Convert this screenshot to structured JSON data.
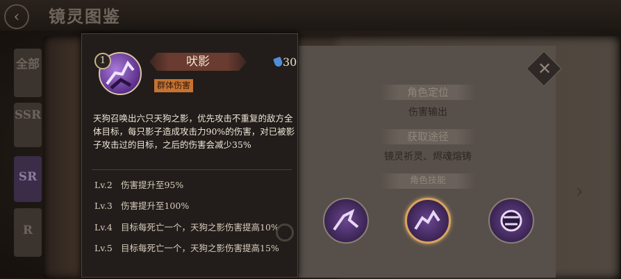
{
  "header": {
    "title": "镜灵图鉴",
    "back_label": "‹"
  },
  "tabs": [
    {
      "label": "全部",
      "active": false
    },
    {
      "label": "SSR",
      "active": false
    },
    {
      "label": "SR",
      "active": true
    },
    {
      "label": "R",
      "active": false
    }
  ],
  "skill_popup": {
    "level": "1",
    "name": "吠影",
    "cost": "30",
    "tag": "群体伤害",
    "description": "天狗召唤出六只天狗之影，优先攻击不重复的敌方全体目标，每只影子造成攻击力90%的伤害，对已被影子攻击过的目标，之后的伤害会减少35%",
    "levels": [
      {
        "label": "Lv.2",
        "text": "伤害提升至95%"
      },
      {
        "label": "Lv.3",
        "text": "伤害提升至100%"
      },
      {
        "label": "Lv.4",
        "text": "目标每死亡一个，天狗之影伤害提高10%"
      },
      {
        "label": "Lv.5",
        "text": "目标每死亡一个，天狗之影伤害提高15%"
      }
    ]
  },
  "info": {
    "role_title": "角色定位",
    "role_value": "伤害输出",
    "source_title": "获取途径",
    "source_value": "镜灵祈灵、烬魂熔铸",
    "skills_title": "角色技能"
  },
  "colors": {
    "accent": "#c87230",
    "skill_purple": "#6a4590",
    "selected_ring": "#d8a560"
  },
  "icons": {
    "close": "close-icon",
    "search": "search-icon",
    "cost": "gem-icon"
  }
}
